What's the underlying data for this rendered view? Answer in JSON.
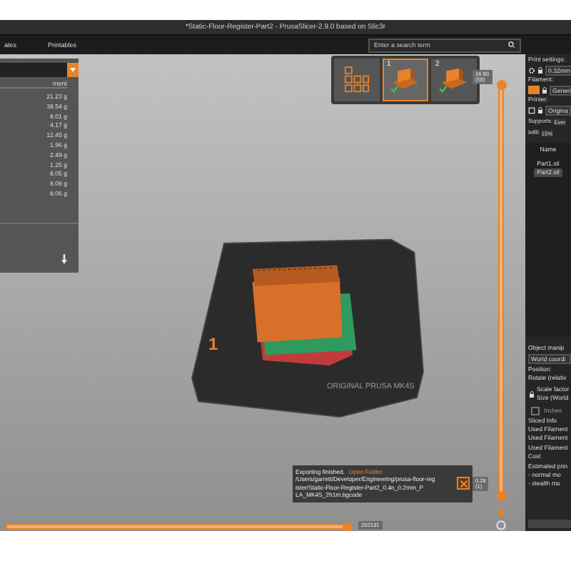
{
  "window": {
    "title": "*Static-Floor-Register-Part2 - PrusaSlicer-2.9.0 based on Slic3r"
  },
  "tabs": [
    {
      "label": "ates",
      "selected": false
    },
    {
      "label": "Printables",
      "selected": false
    }
  ],
  "search": {
    "placeholder": "Enter a search term"
  },
  "legend": {
    "header": "ment",
    "values": [
      "21.23 g",
      "38.54 g",
      "8.01 g",
      "4.17 g",
      "12.45 g",
      "1.96 g",
      "2.49 g",
      "1.25 g",
      "8.05 g",
      "8.08 g",
      "8.06 g"
    ]
  },
  "plates": [
    {
      "number": "1",
      "selected": true
    },
    {
      "number": "2",
      "selected": false
    }
  ],
  "vertical_slider": {
    "top_label": "16.80",
    "top_sub": "(58)",
    "bottom_label": "0.28",
    "bottom_sub": "(1)",
    "level": 1
  },
  "horizontal_slider": {
    "label": "202131",
    "level": 1
  },
  "bed": {
    "number": "1",
    "label": "ORIGINAL PRUSA MK4S"
  },
  "notification": {
    "title": "Exporting finished.",
    "link": "Open Folder.",
    "path": [
      "/Users/garrett/Developer/Engineering/prusa-floor-reg",
      "ister/Static-Floor-Register-Part2_0.4n_0.2mm_P",
      "LA_MK4S_2h1m.bgcode"
    ]
  },
  "sidebar": {
    "print_label": "Print settings:",
    "print_value": "0.32mm",
    "filament_label": "Filament:",
    "filament_value": "Generi",
    "printer_label": "Printer:",
    "printer_value": "Origina",
    "supports_label": "Supports:",
    "supports_value": "Ever",
    "infill_label": "Infill:",
    "infill_value": "15%",
    "list_header": "Name",
    "objects": [
      {
        "name": "Part1.stl",
        "selected": false
      },
      {
        "name": "Part2.stl",
        "selected": true
      }
    ],
    "manip_title": "Object manip",
    "coord_value": "World coordi",
    "position": "Position:",
    "rotate": "Rotate (relativ",
    "scale": "Scale factor",
    "size": "Size (World",
    "inches": {
      "label": "Inches",
      "checked": false
    },
    "sliced_title": "Sliced Info",
    "sliced_lines": [
      "Used Filament",
      "Used Filament",
      "Used Filament",
      "Cost",
      "Estimated prin",
      "- normal mo",
      "- stealth mo"
    ]
  }
}
